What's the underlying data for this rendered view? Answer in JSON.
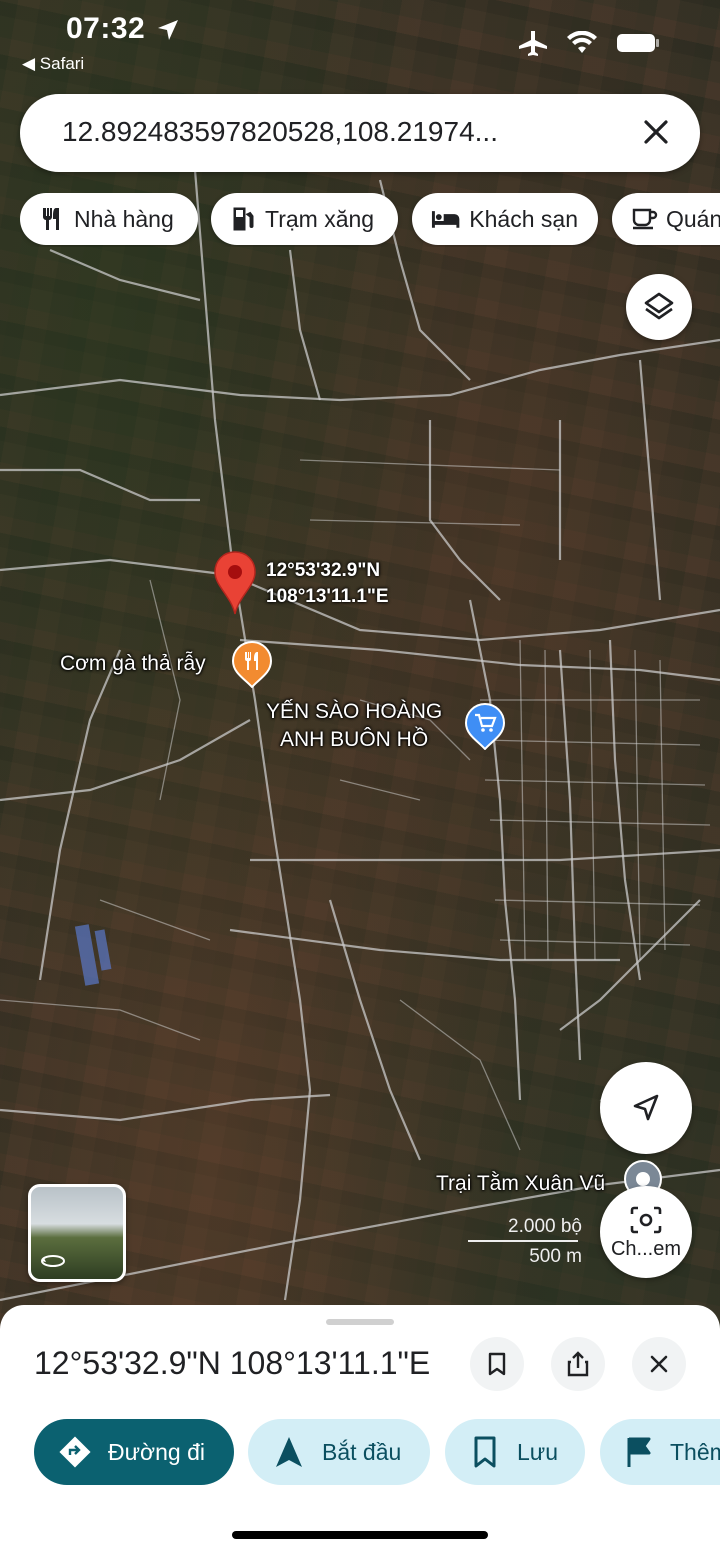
{
  "status_bar": {
    "time": "07:32",
    "back_app": "Safari"
  },
  "search": {
    "value": "12.892483597820528,108.21974..."
  },
  "chips": [
    {
      "label": "Nhà hàng",
      "icon": "restaurant-icon"
    },
    {
      "label": "Trạm xăng",
      "icon": "gas-station-icon"
    },
    {
      "label": "Khách sạn",
      "icon": "hotel-icon"
    },
    {
      "label": "Quán",
      "icon": "cafe-icon"
    }
  ],
  "map": {
    "pin": {
      "lat": "12°53'32.9\"N",
      "lng": "108°13'11.1\"E"
    },
    "pois": [
      {
        "name": "Cơm gà thả rẫy",
        "icon": "restaurant-icon",
        "color": "#f28b30"
      },
      {
        "name_line1": "YẾN SÀO HOÀNG",
        "name_line2": "ANH BUÔN HỒ",
        "icon": "shopping-cart-icon",
        "color": "#3f8ef5"
      },
      {
        "name": "Trại Tằm Xuân Vũ",
        "icon": "place-icon",
        "color": "#7b8896"
      }
    ],
    "scale": {
      "imperial": "2.000 bộ",
      "metric": "500 m"
    },
    "lens_label": "Ch...em"
  },
  "sheet": {
    "title": "12°53'32.9\"N 108°13'11.1\"E",
    "actions": [
      {
        "label": "Đường đi",
        "icon": "directions-icon"
      },
      {
        "label": "Bắt đầu",
        "icon": "navigation-icon"
      },
      {
        "label": "Lưu",
        "icon": "bookmark-icon"
      },
      {
        "label": "Thêm",
        "icon": "flag-icon"
      }
    ]
  },
  "colors": {
    "primary": "#0b6170",
    "secondary": "#d3eef6",
    "pin": "#e94235"
  }
}
